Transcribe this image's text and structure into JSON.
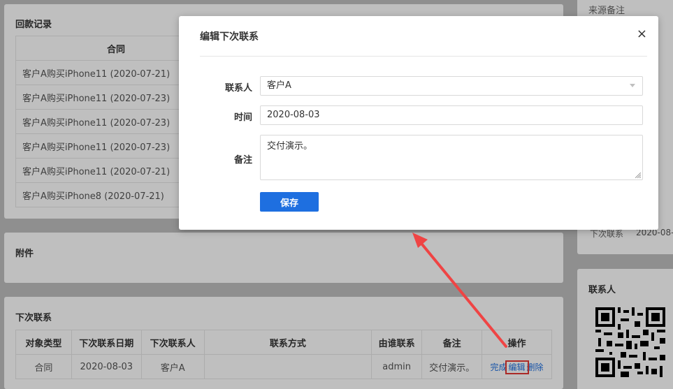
{
  "payment_card": {
    "title": "回款记录",
    "header": "合同",
    "rows": [
      "客户A购买iPhone11 (2020-07-21)",
      "客户A购买iPhone11 (2020-07-23)",
      "客户A购买iPhone11 (2020-07-23)",
      "客户A购买iPhone11 (2020-07-23)",
      "客户A购买iPhone11 (2020-07-21)",
      "客户A购买iPhone8 (2020-07-21)"
    ]
  },
  "attachment_card": {
    "title": "附件"
  },
  "next_contact_card": {
    "title": "下次联系",
    "columns": [
      "对象类型",
      "下次联系日期",
      "下次联系人",
      "联系方式",
      "由谁联系",
      "备注",
      "操作"
    ],
    "row": {
      "type": "合同",
      "date": "2020-08-03",
      "contact": "客户A",
      "method": "",
      "by": "admin",
      "note": "交付演示。",
      "action_done": "完成",
      "action_edit": "编辑",
      "action_delete": "删除"
    }
  },
  "side_panel": {
    "source_note": "来源备注",
    "next_contact_label": "下次联系",
    "next_contact_value": "2020-08-",
    "contact_title": "联系人"
  },
  "modal": {
    "title": "编辑下次联系",
    "close_icon": "×",
    "fields": {
      "contact_label": "联系人",
      "contact_value": "客户A",
      "time_label": "时间",
      "time_value": "2020-08-03",
      "note_label": "备注",
      "note_value": "交付演示。"
    },
    "save_label": "保存"
  },
  "colors": {
    "primary": "#1e6fe0",
    "highlight": "#e53935",
    "arrow": "#ef4444"
  }
}
